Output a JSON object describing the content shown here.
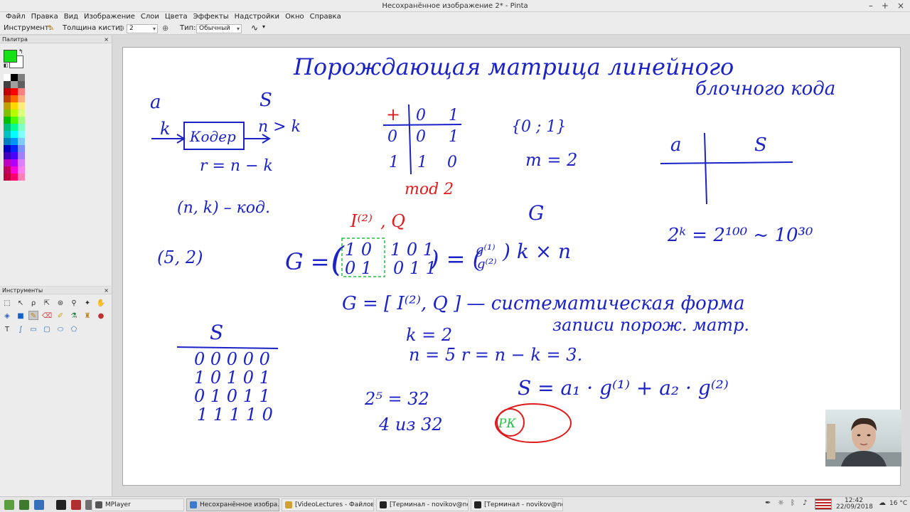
{
  "window": {
    "title": "Несохранённое изображение 2* - Pinta",
    "minimize": "–",
    "maximize": "+",
    "close": "×"
  },
  "menu": [
    "Файл",
    "Правка",
    "Вид",
    "Изображение",
    "Слои",
    "Цвета",
    "Эффекты",
    "Надстройки",
    "Окно",
    "Справка"
  ],
  "toolbar": {
    "tool_label": "Инструмент:",
    "brush_width_label": "Толщина кисти:",
    "brush_width_value": "2",
    "minus": "⊖",
    "plus": "⊕",
    "type_label": "Тип:",
    "type_value": "Обычный",
    "dropdown_arrow": "▾"
  },
  "palette": {
    "title": "Палитра",
    "primary_color": "#18e018",
    "secondary_color": "#ffffff",
    "swatches": [
      "#ffffff",
      "#000000",
      "#7f7f7f",
      "#404040",
      "#a0a0a0",
      "#606060",
      "#c00000",
      "#ff0000",
      "#ff8080",
      "#c04000",
      "#ff6a00",
      "#ffb080",
      "#c0a000",
      "#ffd800",
      "#ffec80",
      "#80c000",
      "#b6ff00",
      "#dcff80",
      "#00c000",
      "#4cff00",
      "#a0ff80",
      "#00c080",
      "#00ff90",
      "#80ffc8",
      "#00c0c0",
      "#00ffff",
      "#80ffff",
      "#0080c0",
      "#0094ff",
      "#80caff",
      "#0000c0",
      "#0026ff",
      "#8092ff",
      "#4000c0",
      "#4800ff",
      "#a080ff",
      "#c000c0",
      "#b200ff",
      "#dc80ff",
      "#c00060",
      "#ff00dc",
      "#ff80ee",
      "#c00040",
      "#ff006e",
      "#ff80b6"
    ]
  },
  "tools_panel": {
    "title": "Инструменты"
  },
  "canvas_text": {
    "title_line1": "Порождающая матрица линейного",
    "title_line2": "блочного кода",
    "a_label": "a",
    "s_label": "S",
    "k_label": "k",
    "coder": "Кодер",
    "n_gt_k": "n > k",
    "r_eq": "r = n − k",
    "nk_code": "(n, k) – код.",
    "five_two": "(5, 2)",
    "plus_sign": "+",
    "tbl_0": "0",
    "tbl_1": "1",
    "mod2": "mod 2",
    "set01": "{0 ; 1}",
    "m_eq": "m = 2",
    "table_a": "a",
    "table_s": "S",
    "power": "2ᵏ = 2¹⁰⁰ ~ 10³⁰",
    "i2": "I⁽²⁾",
    "comma_q": ",  Q",
    "g_big": "G",
    "g_matrix_lhs": "G =",
    "row1_left": "1 0",
    "row2_left": "0 1",
    "row1_right": "1 0 1",
    "row2_right": "0 1 1",
    "eq_paren": ") = (",
    "g1": "g⁽¹⁾",
    "g2": "g⁽²⁾",
    "kxn": ") k × n",
    "g_syst": "G = [ I⁽²⁾, Q ] — систематическая форма",
    "g_syst2": "записи порож. матр.",
    "k_eq": "k = 2",
    "n_eq": "n = 5     r = n − k = 3.",
    "s_sum": "S  =  a₁ · g⁽¹⁾ + a₂ · g⁽²⁾",
    "s_head": "S",
    "code1": "0 0 0 0 0",
    "code2": "1 0 1 0 1",
    "code3": "0 1 0 1 1",
    "code4": "1 1 1 1 0",
    "two5": "2⁵ = 32",
    "four32": "4 из 32",
    "pk": "РК"
  },
  "taskbar": {
    "buttons": [
      {
        "label": "MPlayer",
        "active": false
      },
      {
        "label": "Несохранённое изобра...",
        "active": true
      },
      {
        "label": "[VideoLectures - Файлов...",
        "active": false
      },
      {
        "label": "[Терминал - novikov@no...",
        "active": false
      },
      {
        "label": "[Терминал - novikov@no...",
        "active": false
      }
    ],
    "time": "12:42",
    "date": "22/09/2018",
    "temperature": "16 °C"
  }
}
